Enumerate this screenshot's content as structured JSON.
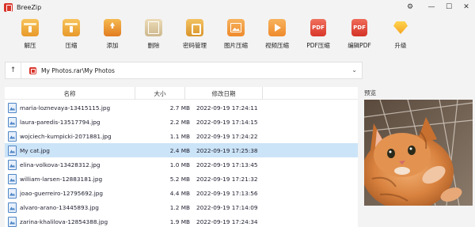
{
  "app": {
    "title": "BreeZip"
  },
  "window_controls": {
    "settings_icon": "gear-icon",
    "minimize": "—",
    "maximize": "☐",
    "close": "✕"
  },
  "toolbar": [
    {
      "id": "extract",
      "label": "解压",
      "icon": "extract-box-icon",
      "color": "#f7c35b"
    },
    {
      "id": "compress",
      "label": "压缩",
      "icon": "compress-box-icon",
      "color": "#f5b950"
    },
    {
      "id": "add",
      "label": "添加",
      "icon": "add-icon",
      "color": "#e27c21"
    },
    {
      "id": "delete",
      "label": "删除",
      "icon": "delete-icon",
      "color": "#cdb88d"
    },
    {
      "id": "password",
      "label": "密码管理",
      "icon": "password-icon",
      "color": "#d9952a"
    },
    {
      "id": "image",
      "label": "图片压缩",
      "icon": "image-compress-icon",
      "color": "#ef8a2c"
    },
    {
      "id": "video",
      "label": "视频压缩",
      "icon": "video-compress-icon",
      "color": "#ef8a2c"
    },
    {
      "id": "pdf",
      "label": "PDF压缩",
      "icon": "pdf-compress-icon",
      "glyph": "PDF",
      "color": "#d9372b"
    },
    {
      "id": "editpdf",
      "label": "编辑PDF",
      "icon": "edit-pdf-icon",
      "glyph": "PDF",
      "color": "#d43327"
    },
    {
      "id": "upgrade",
      "label": "升级",
      "icon": "diamond-icon",
      "color": "#f5a623"
    }
  ],
  "address": {
    "path": "My Photos.rar\\My Photos"
  },
  "columns": {
    "name": "名称",
    "size": "大小",
    "modified": "修改日期"
  },
  "files": [
    {
      "name": "maria-loznevaya-13415115.jpg",
      "size": "2.7 MB",
      "date": "2022-09-19 17:24:11",
      "selected": false
    },
    {
      "name": "laura-paredis-13517794.jpg",
      "size": "2.2 MB",
      "date": "2022-09-19 17:14:15",
      "selected": false
    },
    {
      "name": "wojciech-kumpicki-2071881.jpg",
      "size": "1.1 MB",
      "date": "2022-09-19 17:24:22",
      "selected": false
    },
    {
      "name": "My cat.jpg",
      "size": "2.4 MB",
      "date": "2022-09-19 17:25:38",
      "selected": true
    },
    {
      "name": "elina-volkova-13428312.jpg",
      "size": "1.0 MB",
      "date": "2022-09-19 17:13:45",
      "selected": false
    },
    {
      "name": "william-larsen-12883181.jpg",
      "size": "5.2 MB",
      "date": "2022-09-19 17:21:32",
      "selected": false
    },
    {
      "name": "joao-guerreiro-12795692.jpg",
      "size": "4.4 MB",
      "date": "2022-09-19 17:13:56",
      "selected": false
    },
    {
      "name": "alvaro-arano-13445893.jpg",
      "size": "1.2 MB",
      "date": "2022-09-19 17:14:09",
      "selected": false
    },
    {
      "name": "zarina-khalilova-12854388.jpg",
      "size": "1.9 MB",
      "date": "2022-09-19 17:24:34",
      "selected": false
    }
  ],
  "preview": {
    "label": "预览"
  },
  "colors": {
    "accent": "#d9352b",
    "selection": "#cce4f7"
  }
}
